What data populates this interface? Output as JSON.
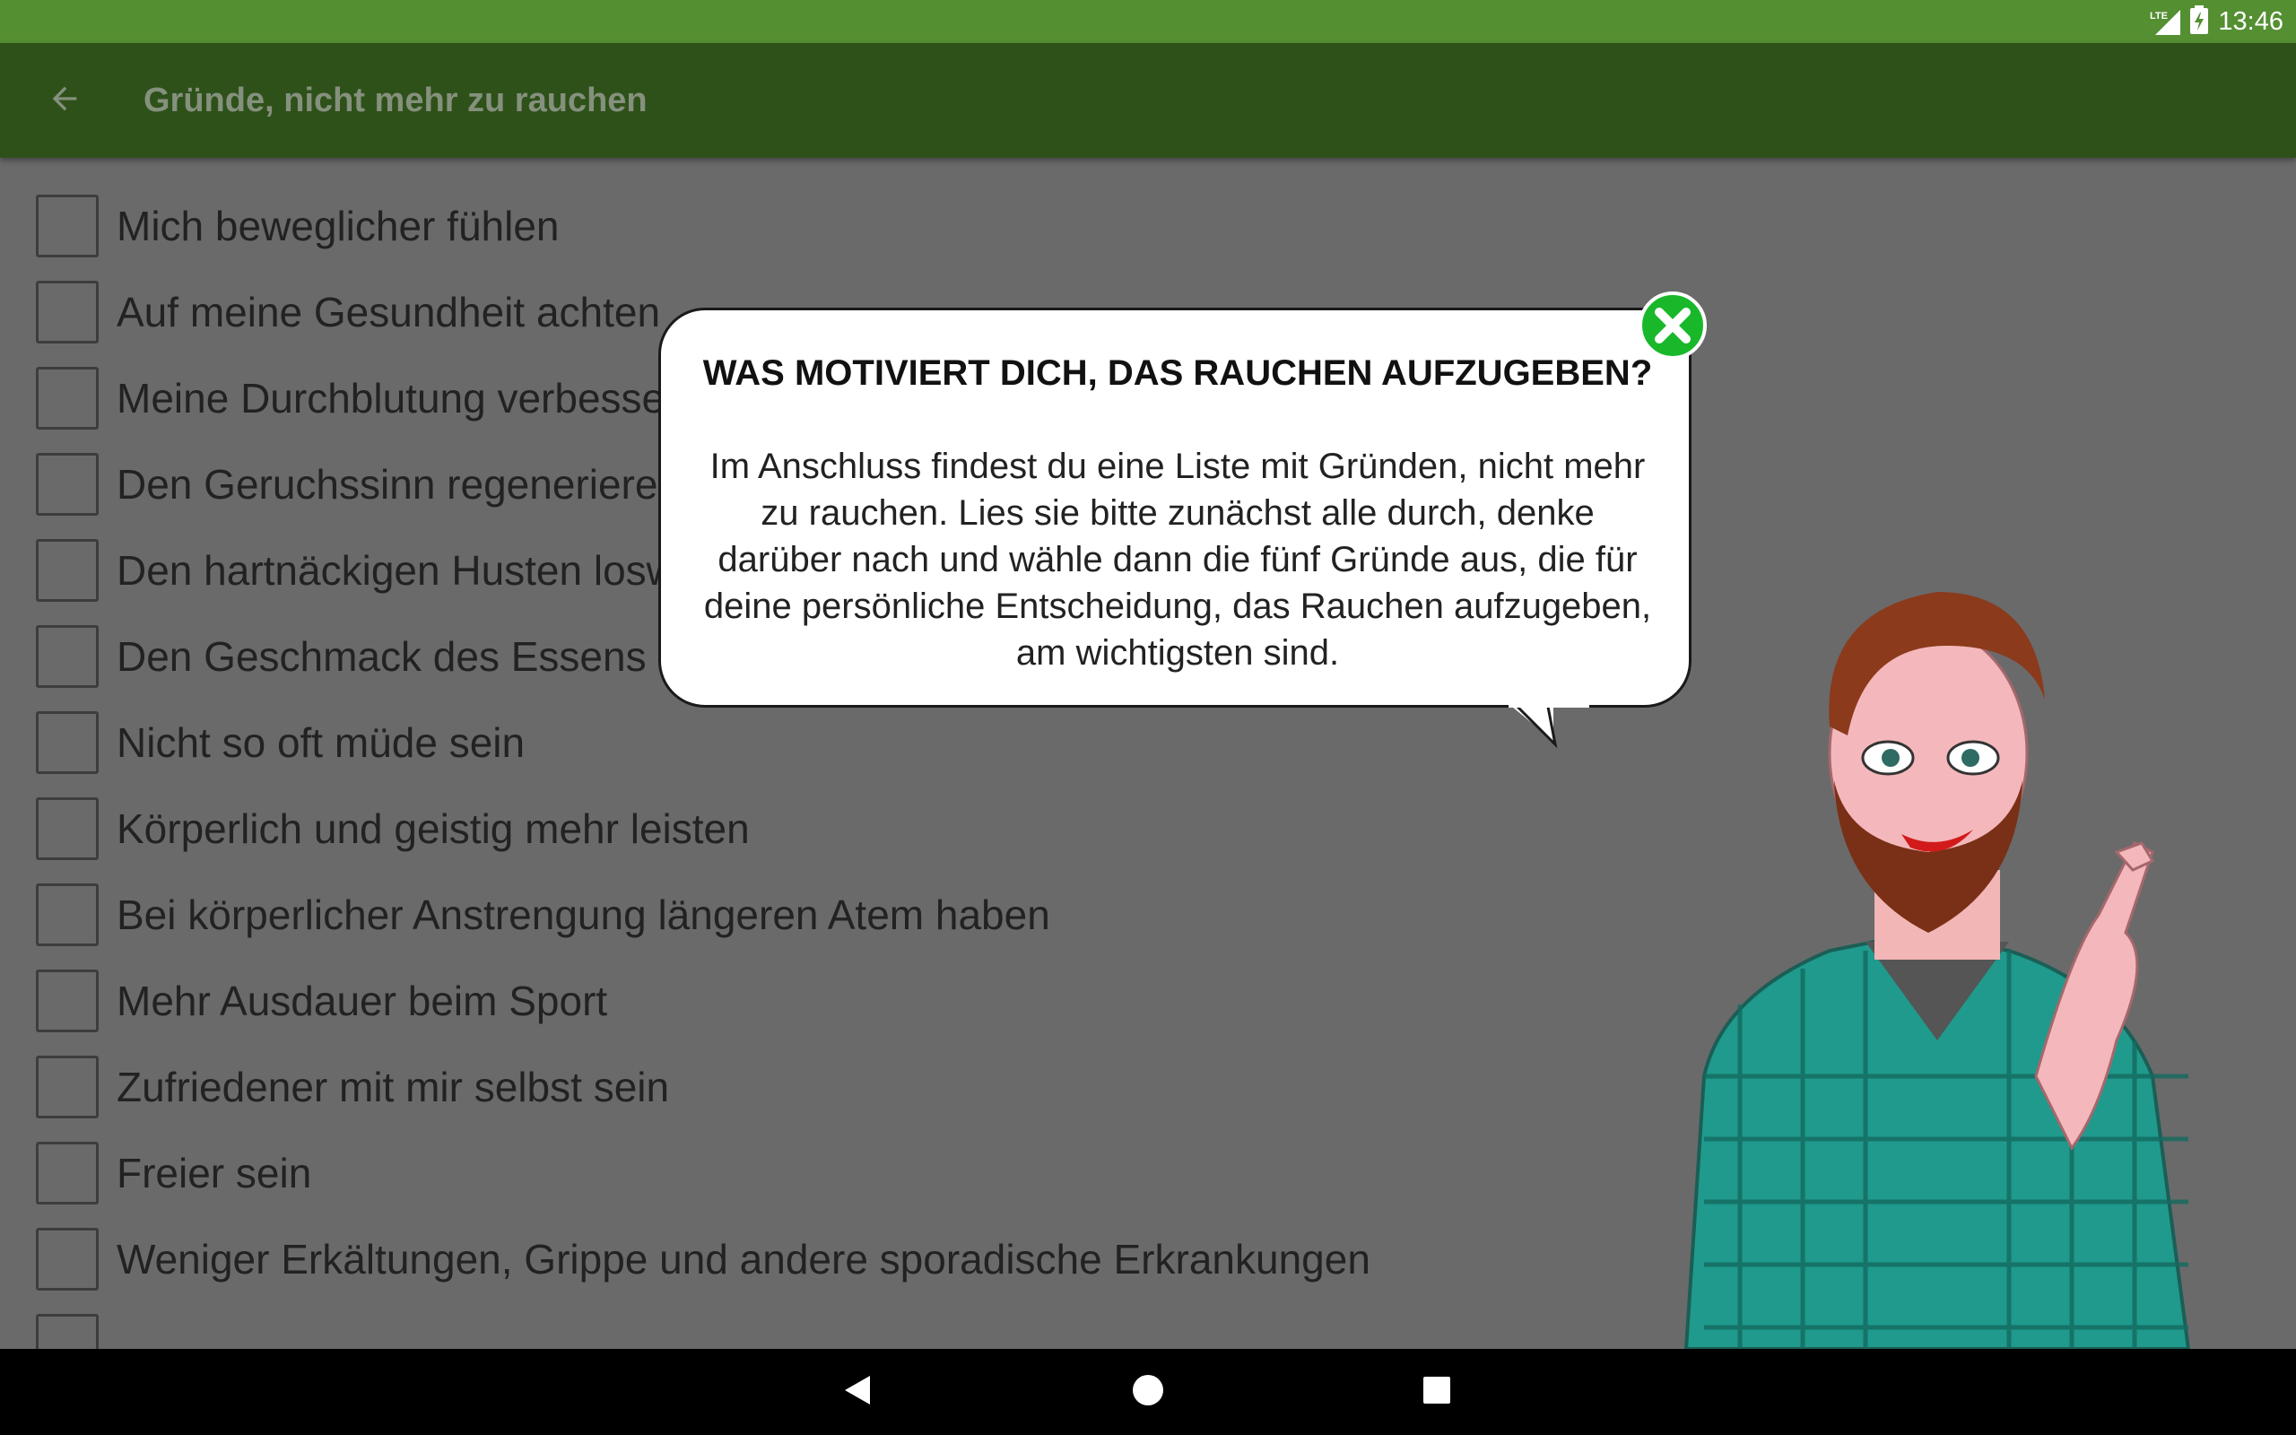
{
  "status_bar": {
    "network": "LTE",
    "time": "13:46"
  },
  "app_bar": {
    "title": "Gründe, nicht mehr zu rauchen"
  },
  "reasons": [
    "Mich beweglicher fühlen",
    "Auf meine Gesundheit achten",
    "Meine Durchblutung verbessern",
    "Den Geruchssinn regenerieren",
    "Den hartnäckigen Husten loswerden",
    "Den Geschmack des Essens genießen",
    "Nicht so oft müde sein",
    "Körperlich und geistig mehr leisten",
    "Bei körperlicher Anstrengung längeren Atem haben",
    "Mehr Ausdauer beim Sport",
    "Zufriedener mit mir selbst sein",
    "Freier sein",
    "Weniger Erkältungen, Grippe und andere sporadische Erkrankungen"
  ],
  "popup": {
    "title": "WAS MOTIVIERT DICH, DAS RAUCHEN AUFZUGEBEN?",
    "body": "Im Anschluss findest du eine Liste mit Gründen, nicht mehr zu rauchen. Lies sie bitte zunächst alle durch, denke darüber nach und wähle dann die fünf Gründe aus, die für deine persönliche Entscheidung, das Rauchen aufzugeben, am wichtigsten sind."
  },
  "colors": {
    "status_bar": "#548f32",
    "app_bar": "#2e5119",
    "overlay_bg": "#6a6a6a",
    "close_green": "#19b82a"
  },
  "icons": {
    "back": "arrow-left-icon",
    "close": "close-circle-icon",
    "nav_back": "triangle-back-icon",
    "nav_home": "circle-home-icon",
    "nav_recents": "square-recents-icon"
  }
}
